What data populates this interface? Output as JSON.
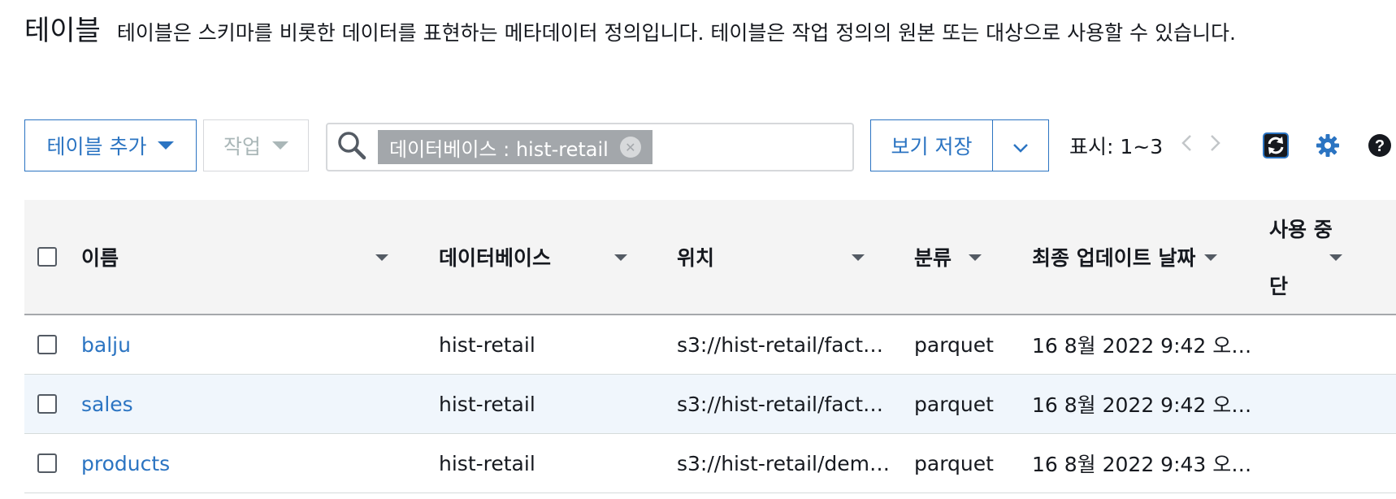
{
  "header": {
    "title": "테이블",
    "description": "테이블은 스키마를 비롯한 데이터를 표현하는 메타데이터 정의입니다. 테이블은 작업 정의의 원본 또는 대상으로 사용할 수 있습니다."
  },
  "toolbar": {
    "add_table_label": "테이블 추가",
    "actions_label": "작업",
    "filter_token": "데이터베이스 : hist-retail",
    "save_view_label": "보기 저장",
    "pagination_text": "표시: 1~3"
  },
  "table": {
    "columns": [
      "이름",
      "데이터베이스",
      "위치",
      "분류",
      "최종 업데이트 날짜",
      "사용 중",
      "단"
    ],
    "rows": [
      {
        "name": "balju",
        "database": "hist-retail",
        "location": "s3://hist-retail/fact…",
        "classification": "parquet",
        "updated": "16 8월 2022 9:42 오…"
      },
      {
        "name": "sales",
        "database": "hist-retail",
        "location": "s3://hist-retail/fact…",
        "classification": "parquet",
        "updated": "16 8월 2022 9:42 오…"
      },
      {
        "name": "products",
        "database": "hist-retail",
        "location": "s3://hist-retail/dem…",
        "classification": "parquet",
        "updated": "16 8월 2022 9:43 오…"
      }
    ]
  },
  "colors": {
    "link": "#2b74c2",
    "header_bg": "#f4f4f4",
    "highlight_row": "#f0f6fc"
  },
  "icons": [
    "search-icon",
    "clear-filter-icon",
    "chevron-down-icon",
    "chevron-left-icon",
    "chevron-right-icon",
    "refresh-icon",
    "gear-icon",
    "help-icon",
    "caret-down-icon"
  ]
}
